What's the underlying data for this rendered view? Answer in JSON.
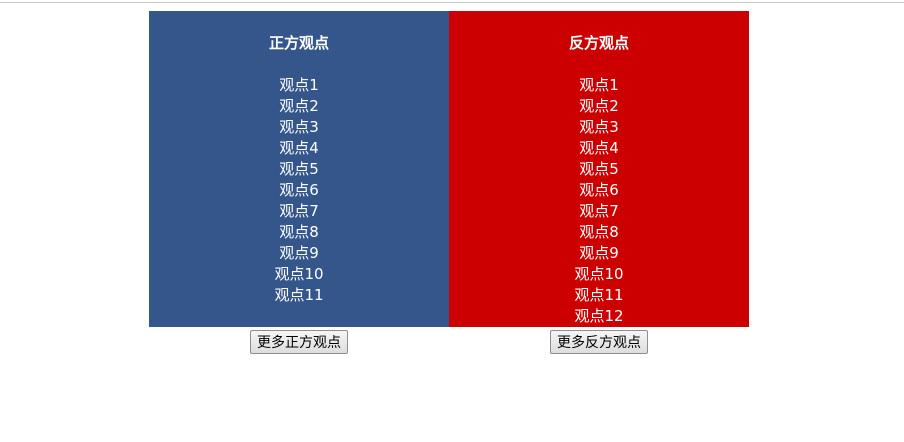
{
  "pro": {
    "title": "正方观点",
    "color": "#34568b",
    "points": [
      "观点1",
      "观点2",
      "观点3",
      "观点4",
      "观点5",
      "观点6",
      "观点7",
      "观点8",
      "观点9",
      "观点10",
      "观点11"
    ],
    "more_label": "更多正方观点"
  },
  "con": {
    "title": "反方观点",
    "color": "#cc0000",
    "points": [
      "观点1",
      "观点2",
      "观点3",
      "观点4",
      "观点5",
      "观点6",
      "观点7",
      "观点8",
      "观点9",
      "观点10",
      "观点11",
      "观点12"
    ],
    "more_label": "更多反方观点"
  }
}
